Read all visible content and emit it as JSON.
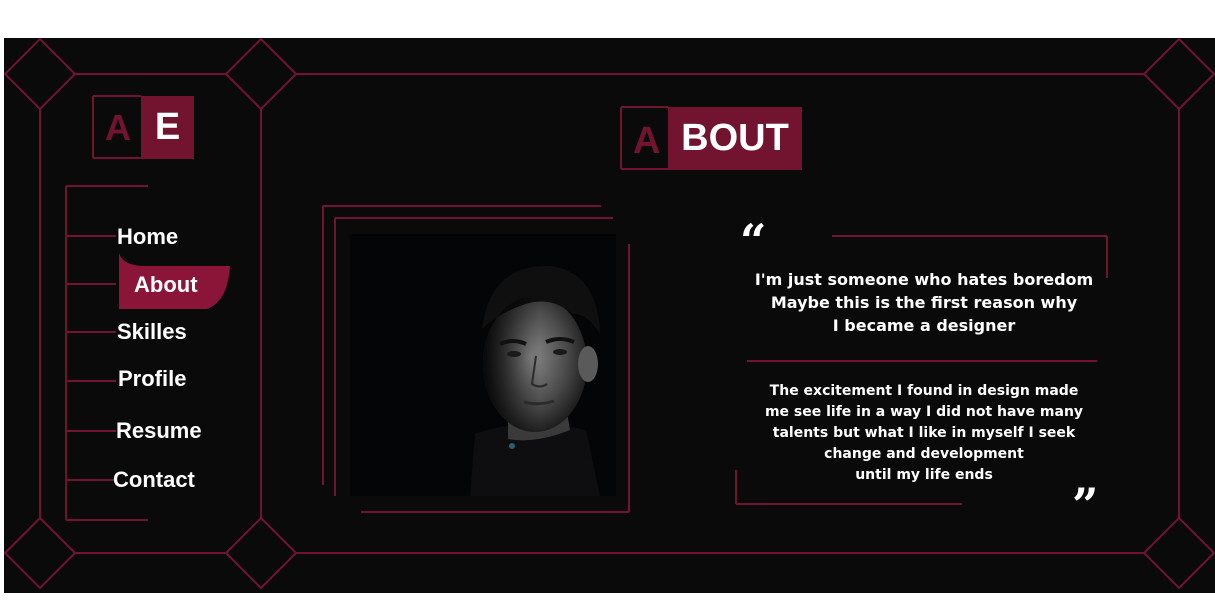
{
  "logo": {
    "letter_outline": "A",
    "letter_box": "E"
  },
  "nav": {
    "items": [
      {
        "label": "Home"
      },
      {
        "label": "About"
      },
      {
        "label": "Skilles"
      },
      {
        "label": "Profile"
      },
      {
        "label": "Resume"
      },
      {
        "label": "Contact"
      }
    ],
    "active_index": 1
  },
  "section_title": {
    "first_letter": "A",
    "rest": "BOUT"
  },
  "quote": {
    "intro_lines": [
      "I'm just someone who hates boredom",
      "Maybe this is the first reason why",
      "I became a designer"
    ],
    "body_lines": [
      "The excitement I found in design made",
      "me see life in a way I did not have many",
      "talents but what I like in myself I seek",
      "change and development",
      "until my life ends"
    ],
    "open_mark": "“",
    "close_mark": "”"
  },
  "colors": {
    "background": "#0a0a0a",
    "accent": "#721330",
    "accent_bright": "#8a1538",
    "text": "#ffffff"
  }
}
